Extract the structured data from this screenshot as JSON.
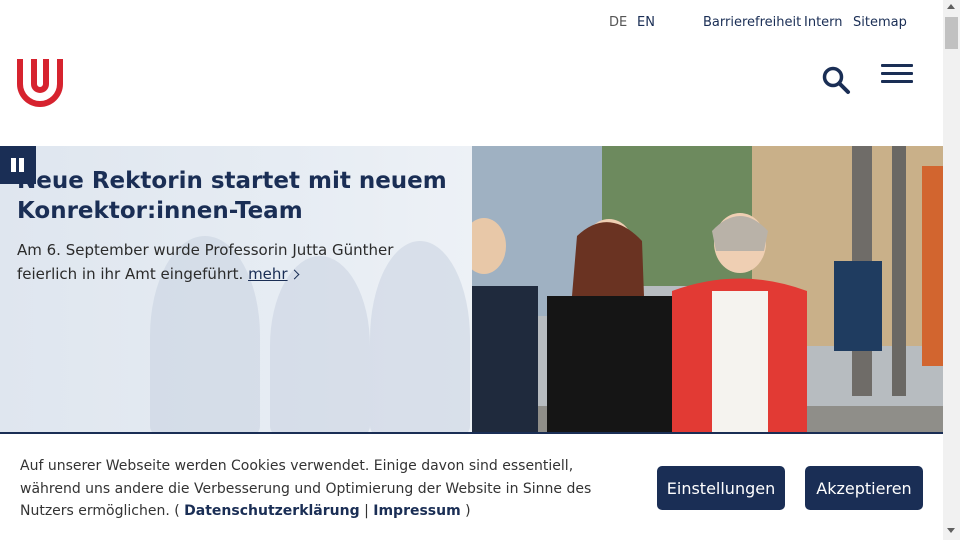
{
  "topbar": {
    "lang_de": "DE",
    "lang_en": "EN",
    "links": [
      "Barrierefreiheit",
      "Intern",
      "Sitemap"
    ]
  },
  "colors": {
    "brand_red": "#d6232f",
    "brand_blue": "#1a2e55"
  },
  "icons": {
    "logo": "university-u-logo",
    "search": "search-icon",
    "menu": "hamburger-menu-icon",
    "pause": "pause-icon"
  },
  "hero": {
    "title": "Neue Rektorin startet mit neuem Konrektor:innen-Team",
    "text": "Am 6. September wurde Professorin Jutta Günther feierlich in ihr Amt eingeführt.",
    "more": "mehr"
  },
  "cookie": {
    "text": "Auf unserer Webseite werden Cookies verwendet. Einige davon sind essentiell, während uns andere die Verbesserung und Optimierung der Website in Sinne des Nutzers ermöglichen. (",
    "privacy_link": "Datenschutzerklärung",
    "separator": "|",
    "imprint_link": "Impressum",
    "close_paren": ")",
    "settings_button": "Einstellungen",
    "accept_button": "Akzeptieren"
  }
}
